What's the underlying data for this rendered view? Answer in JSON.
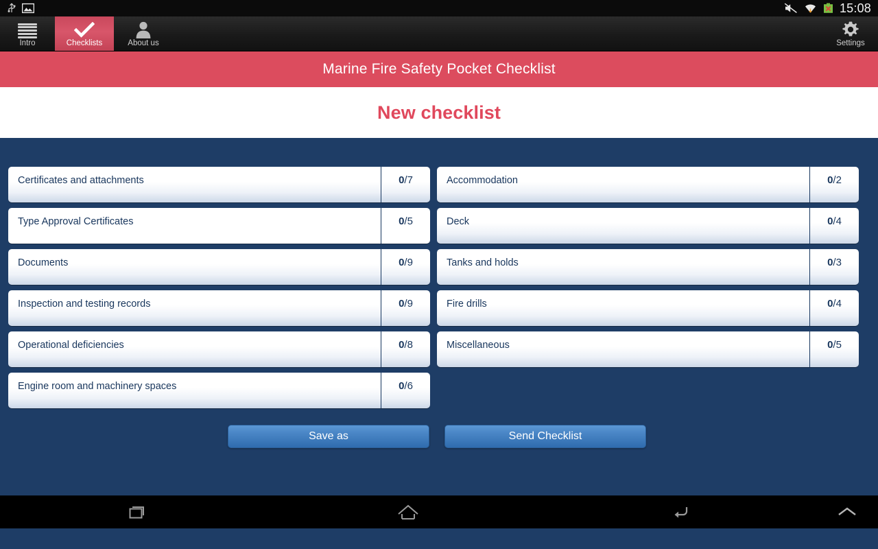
{
  "status_bar": {
    "icons": [
      "usb-icon",
      "screenshot-image-icon"
    ],
    "right_icons": [
      "mute-icon",
      "wifi-icon",
      "battery-error-icon"
    ],
    "clock": "15:08"
  },
  "tabbar": {
    "tabs": [
      {
        "label": "Intro",
        "icon": "list-lines-icon",
        "active": false
      },
      {
        "label": "Checklists",
        "icon": "checkmark-icon",
        "active": true
      },
      {
        "label": "About us",
        "icon": "person-icon",
        "active": false
      }
    ],
    "settings": {
      "label": "Settings",
      "icon": "gear-icon"
    }
  },
  "app_banner": {
    "title": "Marine Fire Safety Pocket Checklist"
  },
  "page": {
    "title": "New checklist"
  },
  "checklist": {
    "left_column": [
      {
        "label": "Certificates and attachments",
        "done": "0",
        "total": "/7",
        "shaded": true
      },
      {
        "label": "Type Approval Certificates",
        "done": "0",
        "total": "/5",
        "shaded": false
      },
      {
        "label": "Documents",
        "done": "0",
        "total": "/9",
        "shaded": true
      },
      {
        "label": "Inspection and testing records",
        "done": "0",
        "total": "/9",
        "shaded": true
      },
      {
        "label": "Operational deficiencies",
        "done": "0",
        "total": "/8",
        "shaded": true
      },
      {
        "label": "Engine room and machinery spaces",
        "done": "0",
        "total": "/6",
        "shaded": true
      }
    ],
    "right_column": [
      {
        "label": "Accommodation",
        "done": "0",
        "total": "/2",
        "shaded": true
      },
      {
        "label": "Deck",
        "done": "0",
        "total": "/4",
        "shaded": true
      },
      {
        "label": "Tanks and holds",
        "done": "0",
        "total": "/3",
        "shaded": true
      },
      {
        "label": "Fire drills",
        "done": "0",
        "total": "/4",
        "shaded": true
      },
      {
        "label": "Miscellaneous",
        "done": "0",
        "total": "/5",
        "shaded": true
      }
    ]
  },
  "actions": {
    "save_as": "Save as",
    "send_checklist": "Send Checklist"
  },
  "navbar": {
    "recents": "recent-apps-icon",
    "home": "home-icon",
    "back": "back-icon",
    "chevron": "chevron-up-icon"
  },
  "colors": {
    "accent_red": "#dc4c5e",
    "background_navy": "#1e3d66",
    "button_blue": "#4a86c6",
    "text_navy": "#17355c"
  }
}
